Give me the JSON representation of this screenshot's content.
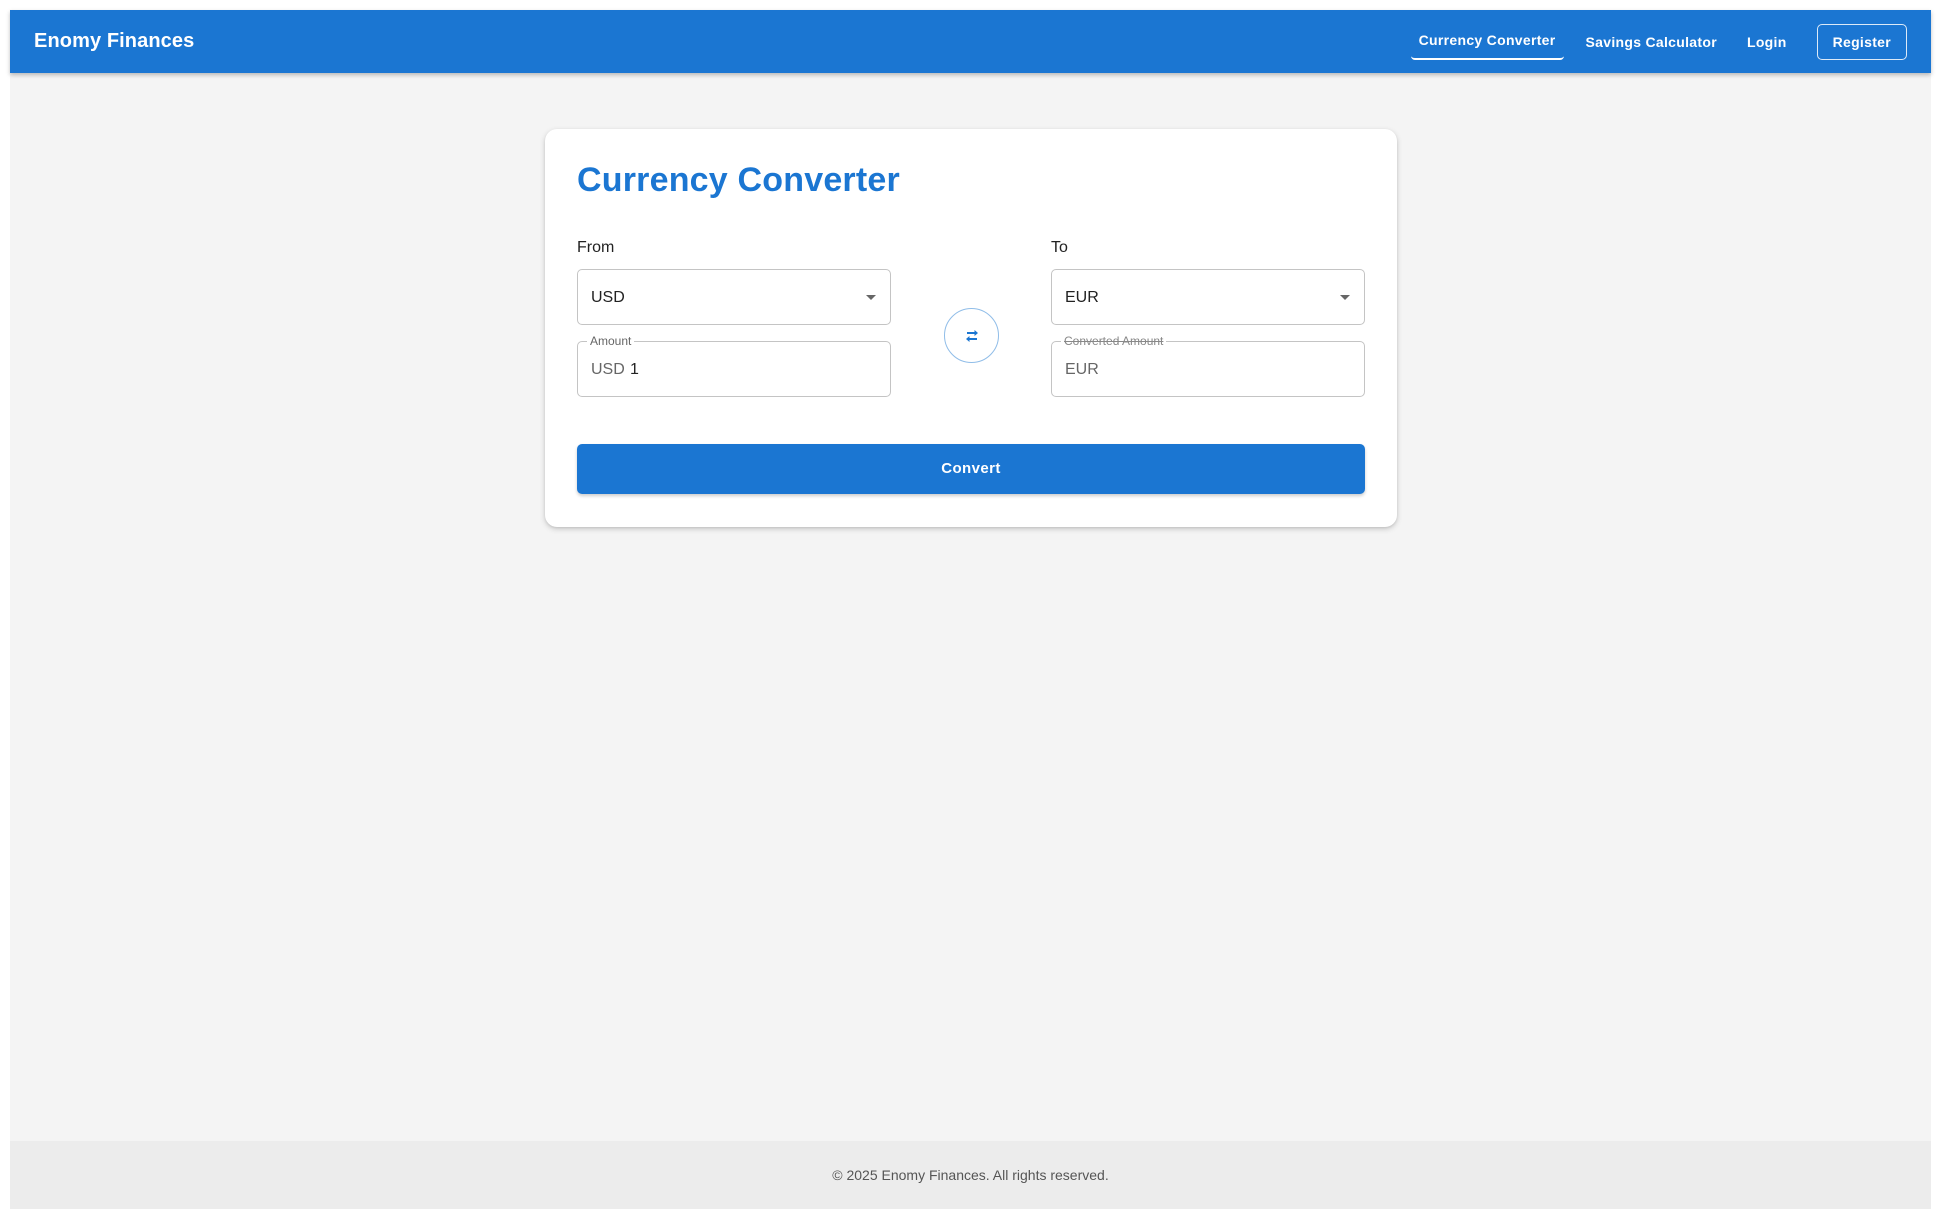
{
  "header": {
    "brand": "Enomy Finances",
    "nav": {
      "currency_converter": "Currency Converter",
      "savings_calculator": "Savings Calculator",
      "login": "Login",
      "register": "Register"
    },
    "active_item": "Currency Converter"
  },
  "converter": {
    "title": "Currency Converter",
    "from": {
      "label": "From",
      "selected": "USD",
      "amount_label": "Amount",
      "amount_prefix": "USD",
      "amount_value": "1"
    },
    "to": {
      "label": "To",
      "selected": "EUR",
      "converted_label": "Converted Amount",
      "converted_prefix": "EUR",
      "converted_value": ""
    },
    "swap_icon": "swap-horizontal-icon",
    "convert_label": "Convert"
  },
  "footer": {
    "text": "© 2025 Enomy Finances. All rights reserved."
  },
  "colors": {
    "primary": "#1b76d2",
    "background": "#f4f4f4",
    "footer_bg": "#ececec"
  }
}
